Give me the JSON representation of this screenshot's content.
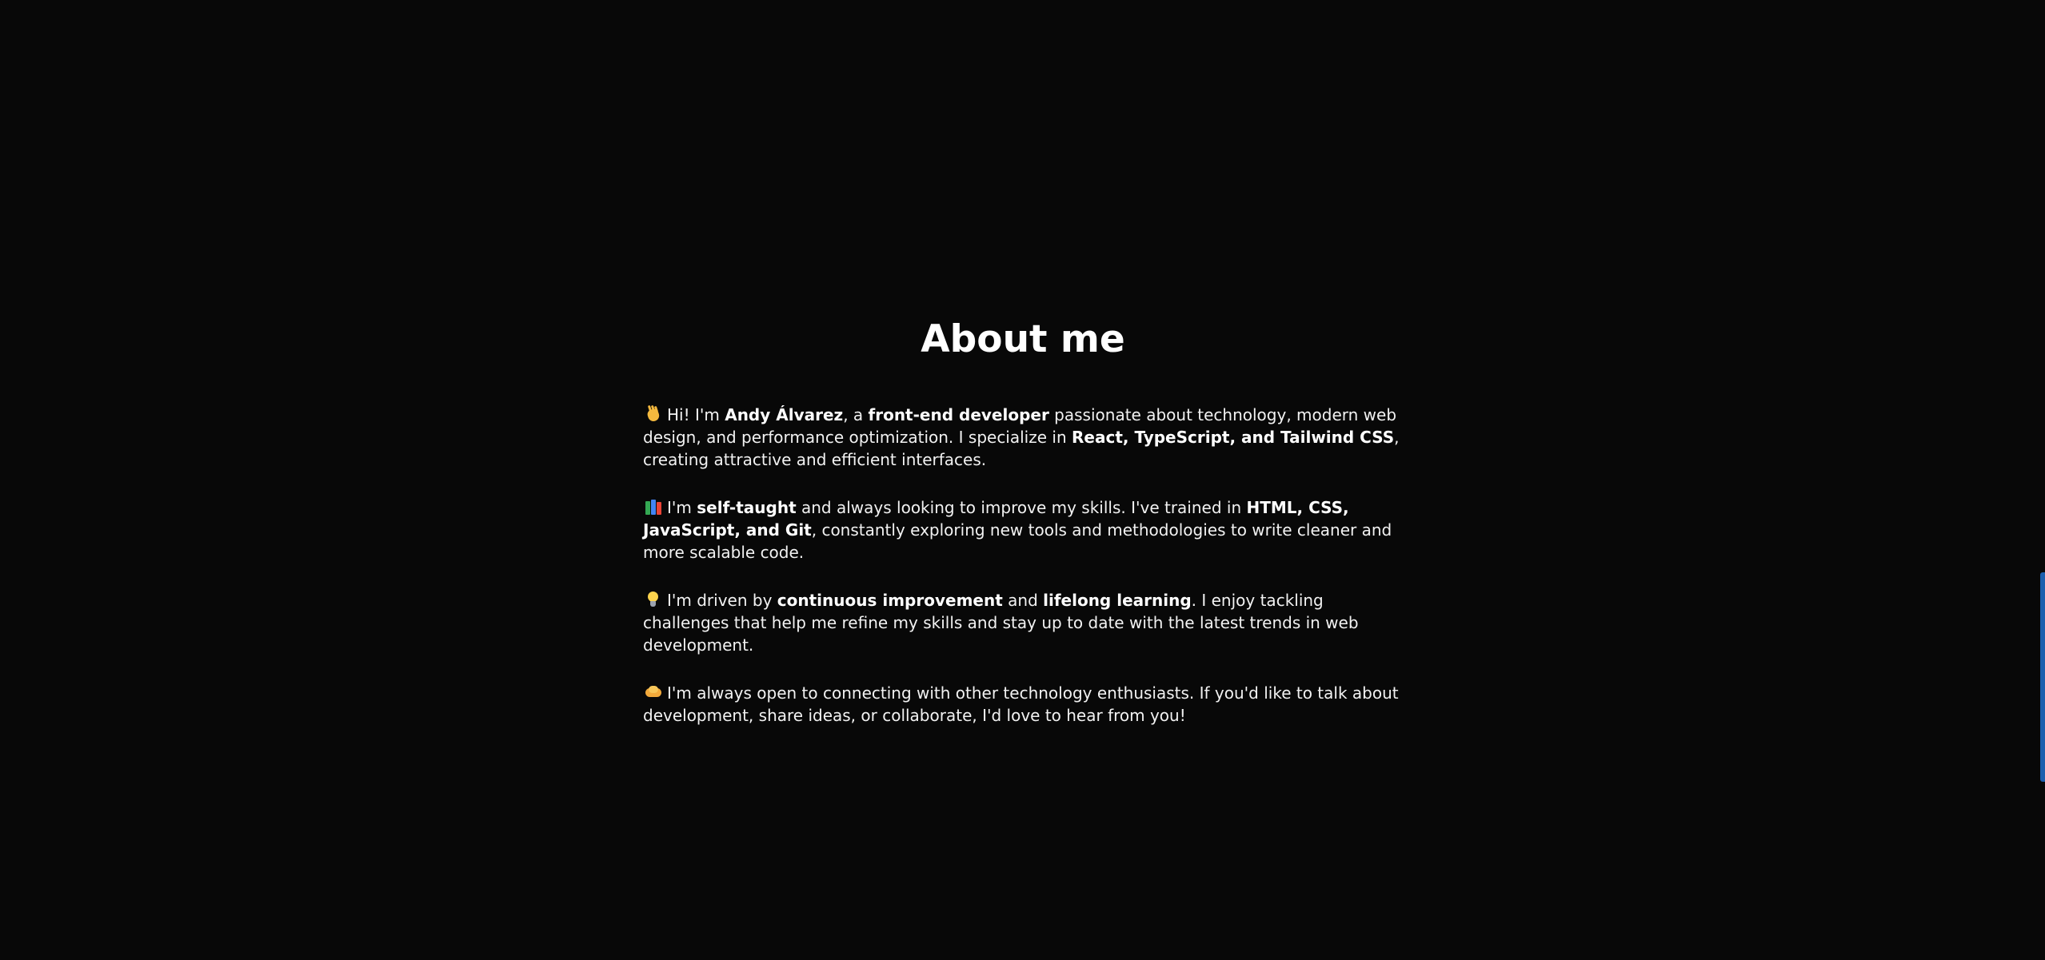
{
  "about": {
    "title": "About me",
    "paragraphs": [
      {
        "emoji": "waving-hand",
        "parts": [
          {
            "t": "Hi! I'm ",
            "b": false
          },
          {
            "t": "Andy Álvarez",
            "b": true
          },
          {
            "t": ", a ",
            "b": false
          },
          {
            "t": "front-end developer",
            "b": true
          },
          {
            "t": " passionate about technology, modern web design, and performance optimization. I specialize in ",
            "b": false
          },
          {
            "t": "React, TypeScript, and Tailwind CSS",
            "b": true
          },
          {
            "t": ", creating attractive and efficient interfaces.",
            "b": false
          }
        ]
      },
      {
        "emoji": "books",
        "parts": [
          {
            "t": "I'm ",
            "b": false
          },
          {
            "t": "self-taught",
            "b": true
          },
          {
            "t": " and always looking to improve my skills. I've trained in ",
            "b": false
          },
          {
            "t": "HTML, CSS, JavaScript, and Git",
            "b": true
          },
          {
            "t": ", constantly exploring new tools and methodologies to write cleaner and more scalable code.",
            "b": false
          }
        ]
      },
      {
        "emoji": "light-bulb",
        "parts": [
          {
            "t": "I'm driven by ",
            "b": false
          },
          {
            "t": "continuous improvement",
            "b": true
          },
          {
            "t": " and ",
            "b": false
          },
          {
            "t": "lifelong learning",
            "b": true
          },
          {
            "t": ". I enjoy tackling challenges that help me refine my skills and stay up to date with the latest trends in web development.",
            "b": false
          }
        ]
      },
      {
        "emoji": "handshake",
        "parts": [
          {
            "t": "I'm always open to connecting with other technology enthusiasts. If you'd like to talk about development, share ideas, or collaborate, I'd love to hear from you!",
            "b": false
          }
        ]
      }
    ]
  },
  "colors": {
    "background": "#080808",
    "text": "#ffffff",
    "scrollbar": "#1c5fae"
  }
}
